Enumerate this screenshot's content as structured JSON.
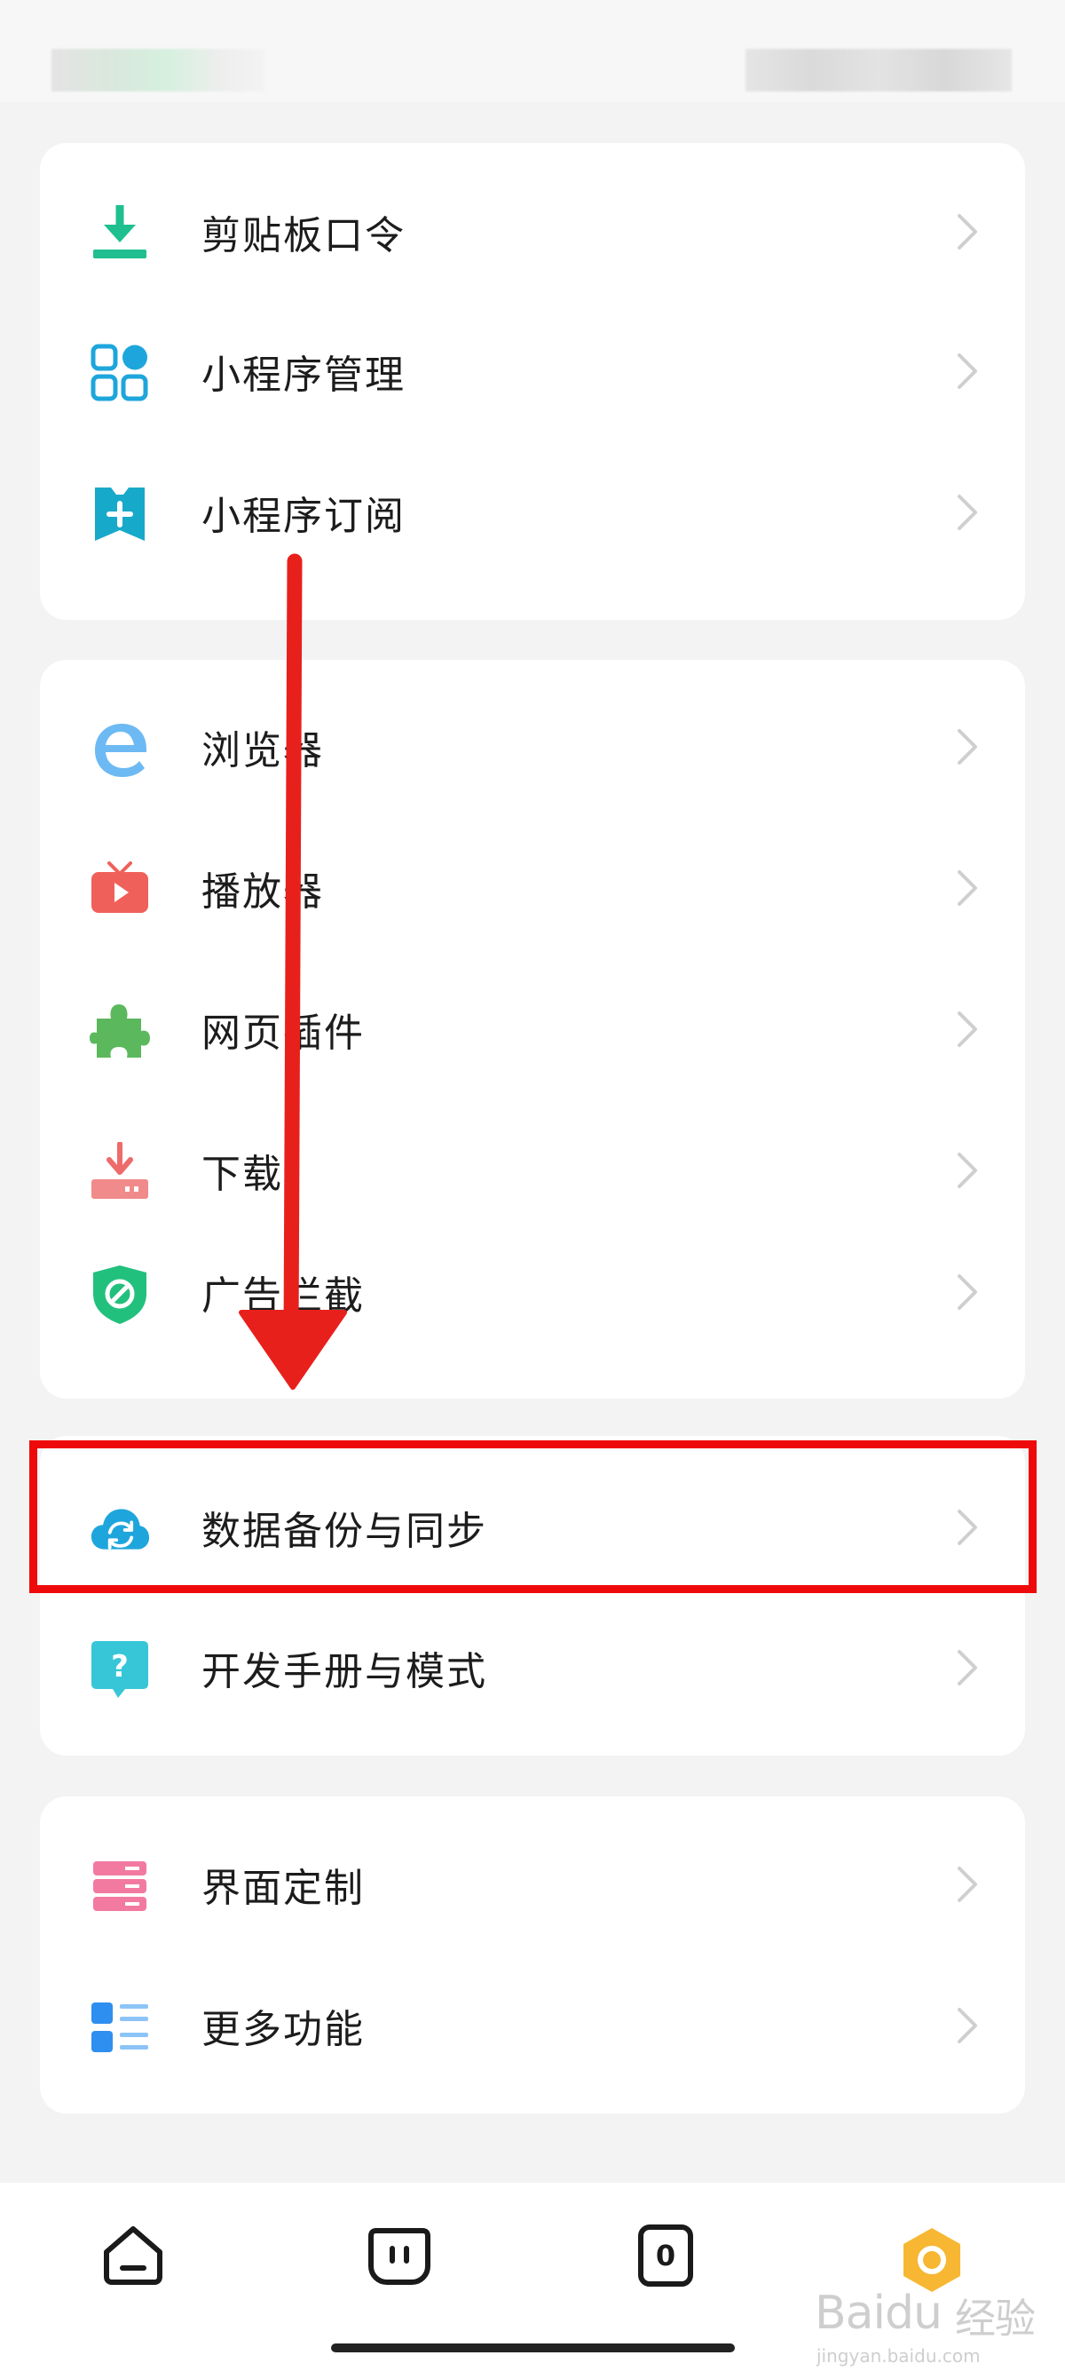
{
  "card1": {
    "items": [
      {
        "label": "剪贴板口令",
        "icon": "clipboard-download-icon"
      },
      {
        "label": "小程序管理",
        "icon": "grid-apps-icon"
      },
      {
        "label": "小程序订阅",
        "icon": "bookmark-plus-icon"
      }
    ]
  },
  "card2": {
    "items": [
      {
        "label": "浏览器",
        "icon": "browser-e-icon"
      },
      {
        "label": "播放器",
        "icon": "tv-play-icon"
      },
      {
        "label": "网页插件",
        "icon": "puzzle-icon"
      },
      {
        "label": "下载",
        "icon": "download-tray-icon"
      },
      {
        "label": "广告拦截",
        "icon": "shield-block-icon"
      }
    ]
  },
  "card3": {
    "items": [
      {
        "label": "数据备份与同步",
        "icon": "cloud-sync-icon"
      },
      {
        "label": "开发手册与模式",
        "icon": "question-bubble-icon"
      }
    ]
  },
  "card4": {
    "items": [
      {
        "label": "界面定制",
        "icon": "layers-list-icon"
      },
      {
        "label": "更多功能",
        "icon": "more-list-icon"
      }
    ]
  },
  "bottom_nav": {
    "tabs": [
      {
        "icon": "home-icon"
      },
      {
        "icon": "chat-face-icon"
      },
      {
        "icon": "tabs-count-icon",
        "count": "0"
      },
      {
        "icon": "profile-hex-icon"
      }
    ]
  },
  "watermark": {
    "brand": "Baidu",
    "cn": "经验",
    "url": "jingyan.baidu.com"
  },
  "colors": {
    "highlight": "#ee0a0a",
    "arrow": "#e8201c",
    "accent_green": "#1fbf8f",
    "accent_blue": "#1ea6dc"
  }
}
